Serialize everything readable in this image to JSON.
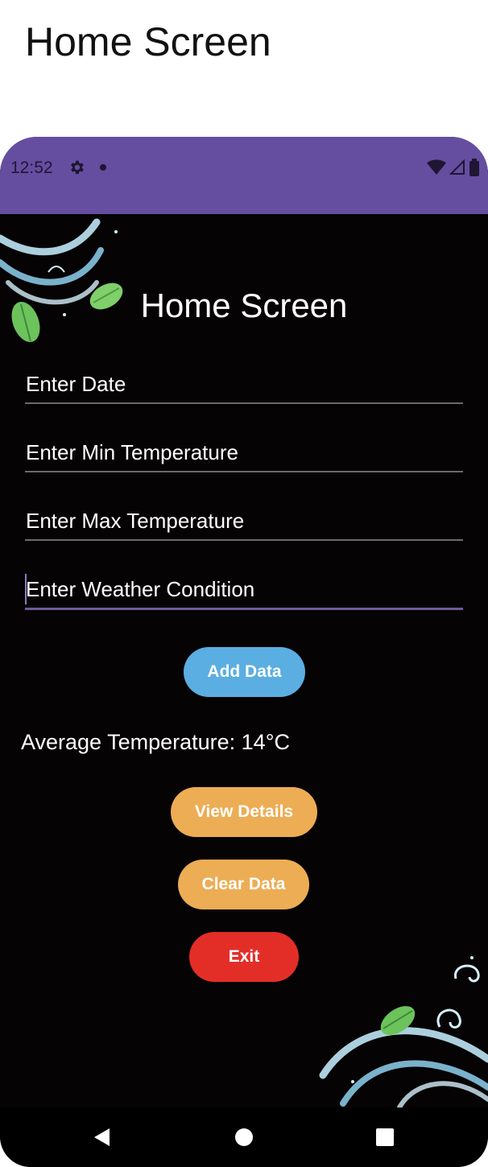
{
  "page": {
    "caption": "Home Screen"
  },
  "status_bar": {
    "time": "12:52",
    "background": "#654ea0",
    "icons": [
      "gear-icon",
      "notification-dot-icon",
      "wifi-icon",
      "signal-icon",
      "battery-icon"
    ]
  },
  "app": {
    "title": "Home Screen",
    "fields": {
      "date": {
        "placeholder": "Enter Date",
        "value": ""
      },
      "min_temp": {
        "placeholder": "Enter Min Temperature",
        "value": ""
      },
      "max_temp": {
        "placeholder": "Enter Max Temperature",
        "value": ""
      },
      "condition": {
        "placeholder": "Enter Weather Condition",
        "value": ""
      }
    },
    "buttons": {
      "add": "Add Data",
      "view": "View Details",
      "clear": "Clear Data",
      "exit": "Exit"
    },
    "average_temperature": "Average Temperature: 14°C"
  },
  "colors": {
    "add_button": "#5aaee2",
    "view_button": "#ecad55",
    "clear_button": "#ecad55",
    "exit_button": "#e32e28",
    "background": "#060304",
    "focus_underline": "#6d5a96"
  },
  "nav_bar": {
    "icons": [
      "back-triangle-icon",
      "home-circle-icon",
      "recents-square-icon"
    ]
  }
}
